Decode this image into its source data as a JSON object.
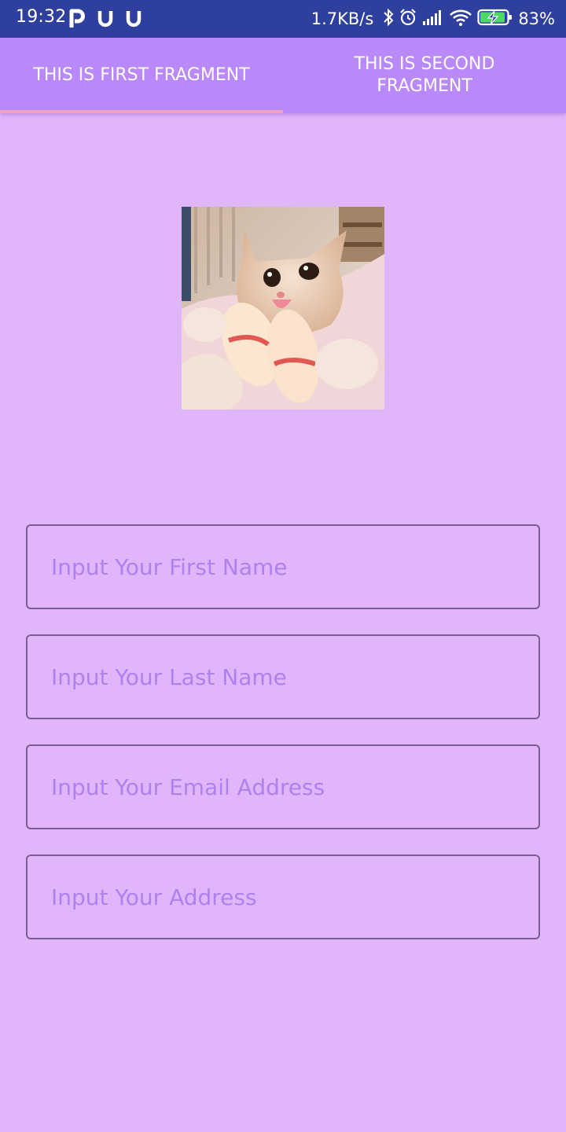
{
  "status_bar": {
    "time": "19:32",
    "network_speed": "1.7KB/s",
    "battery_percent": "83%",
    "notification_icons": [
      "p-app-icon",
      "u-app-icon",
      "u-app-icon"
    ]
  },
  "tabs": [
    {
      "label": "THIS IS FIRST FRAGMENT",
      "selected": true
    },
    {
      "label": "THIS IS SECOND FRAGMENT",
      "selected": false
    }
  ],
  "colors": {
    "status_bar": "#2f3f9e",
    "tab_bar": "#b988f9",
    "tab_indicator": "#f3a0c6",
    "background": "#e1b5fa",
    "input_border": "#7a5c94",
    "placeholder": "#b180ef"
  },
  "form": {
    "first_name": {
      "value": "",
      "placeholder": "Input Your First Name"
    },
    "last_name": {
      "value": "",
      "placeholder": "Input Your Last Name"
    },
    "email": {
      "value": "",
      "placeholder": "Input Your Email Address"
    },
    "address": {
      "value": "",
      "placeholder": "Input Your Address"
    }
  }
}
